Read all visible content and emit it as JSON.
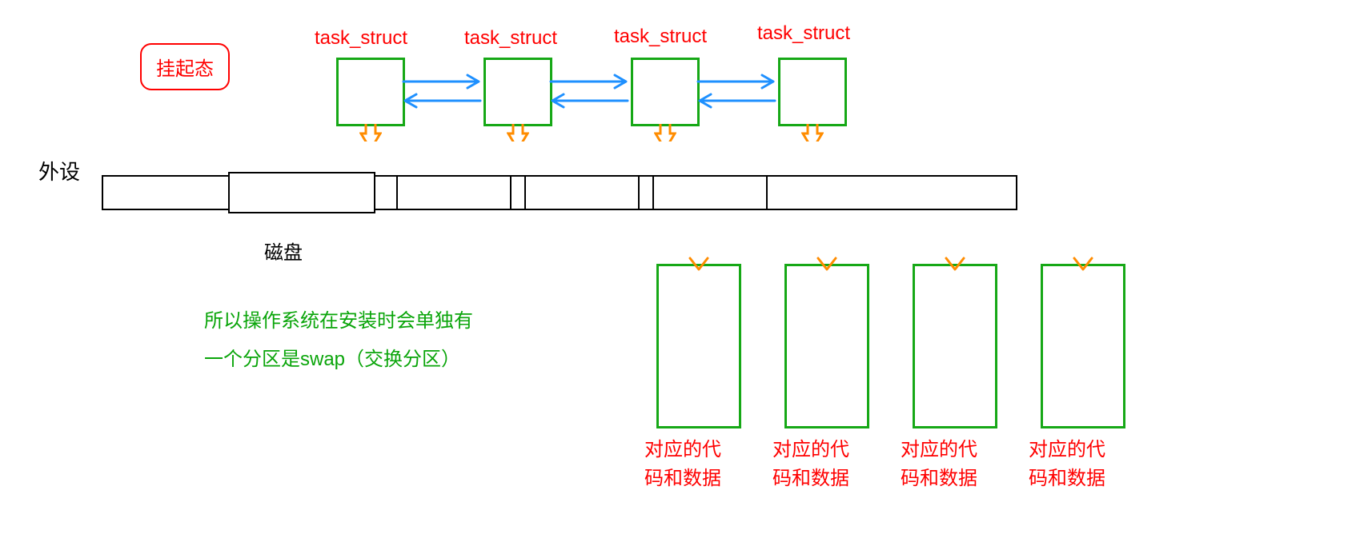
{
  "state": {
    "label": "挂起态"
  },
  "task_struct_labels": [
    "task_struct",
    "task_struct",
    "task_struct",
    "task_struct"
  ],
  "peripheral": {
    "heading": "外设",
    "disk_label": "磁盘"
  },
  "note": {
    "line1": "所以操作系统在安装时会单独有",
    "line2": "一个分区是swap（交换分区）"
  },
  "swap_blocks": {
    "line1": "对应的代",
    "line2": "码和数据"
  },
  "colors": {
    "red": "#ff0000",
    "green": "#16a816",
    "blue": "#1e90ff",
    "orange": "#ff8c00",
    "black": "#000000"
  }
}
